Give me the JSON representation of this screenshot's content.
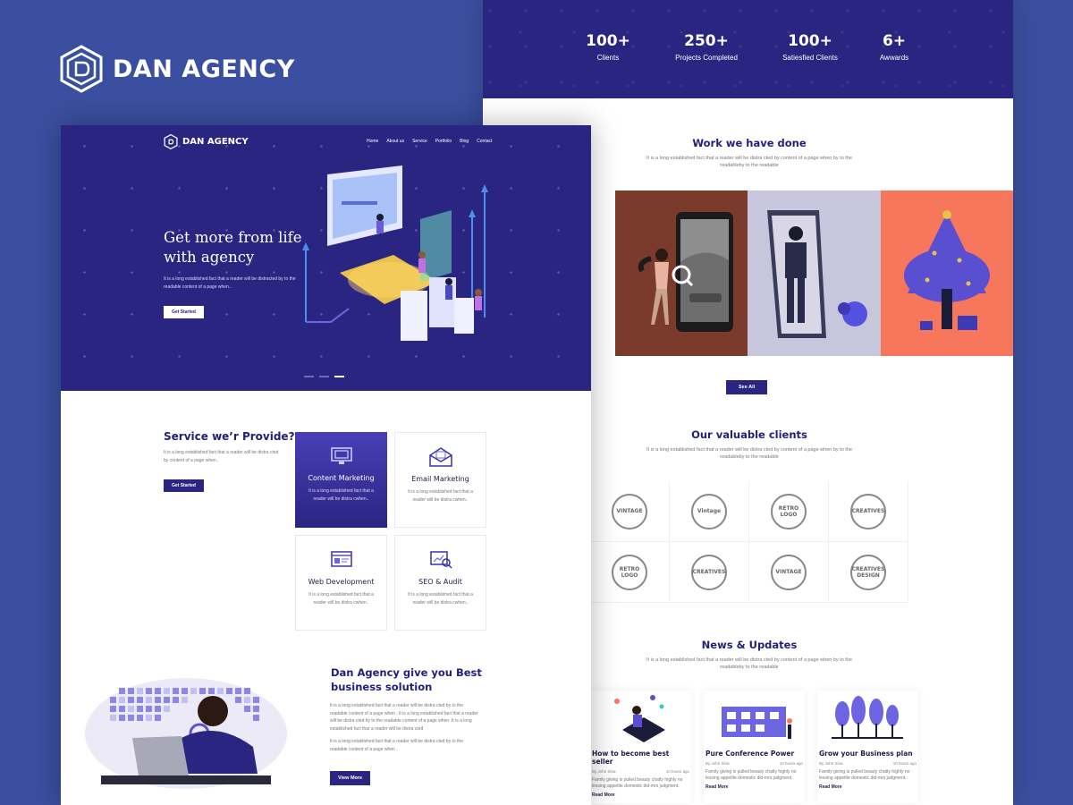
{
  "brand": {
    "title": "DAN AGENCY"
  },
  "stats": [
    {
      "value": "100+",
      "label": "Clients"
    },
    {
      "value": "250+",
      "label": "Projects Completed"
    },
    {
      "value": "100+",
      "label": "Satiesfied Clients"
    },
    {
      "value": "6+",
      "label": "Awwards"
    }
  ],
  "work": {
    "title": "Work we have done",
    "desc": "It is a long established fact that a reader will be distra cted by content of a page when by to the readableby to the readable",
    "button": "See All"
  },
  "clients": {
    "title": "Our valuable clients",
    "desc": "It is a long established fact that a reader will be distra cted by content of a page when by to the readableby to the readable",
    "logos": [
      "VINTAGE",
      "Vintage",
      "RETRO LOGO",
      "CREATIVES",
      "RETRO LOGO",
      "CREATIVES",
      "VINTAGE",
      "CREATIVES DESIGN"
    ]
  },
  "news": {
    "title": "News & Updates",
    "desc": "It is a long established fact that a reader will be distra cted by content of a page when by to the readableby to the readable",
    "items": [
      {
        "title": "How to become best seller",
        "author": "By John Sina",
        "time": "10 hours ago",
        "text": "Family giving is pulled beauty chatty highly no lessing appetite domestic did-mrs judgment.",
        "read": "Read More"
      },
      {
        "title": "Pure Conference Power",
        "author": "By John Sina",
        "time": "10 hours ago",
        "text": "Family giving is pulled beauty chatty highly no lessing appetite domestic did-mrs judgment.",
        "read": "Read More"
      },
      {
        "title": "Grow your Business plan",
        "author": "By John Sina",
        "time": "10 hours ago",
        "text": "Family giving is pulled beauty chatty highly no lessing appetite domestic did-mrs judgment.",
        "read": "Read More"
      }
    ]
  },
  "nav": {
    "brand": "DAN AGENCY",
    "items": [
      "Home",
      "About us",
      "Service",
      "Portfolio",
      "Blog",
      "Contact"
    ]
  },
  "hero": {
    "title": "Get more from life with agency",
    "desc": "It is a long established fact that a reader will be distracted by to the readable content of a page when..",
    "button": "Get Started"
  },
  "services": {
    "title": "Service we’r Provide?",
    "desc": "It is a long established fact that a reader will be distra cted by content of a page when..",
    "button": "Get Started",
    "cards": [
      {
        "title": "Content Marketing",
        "desc": "It is a long established fact that a reader will be distra cwhen.."
      },
      {
        "title": "Email Marketing",
        "desc": "It is a long established fact that a reader will be distra cwhen.."
      },
      {
        "title": "Web Development",
        "desc": "It is a long established fact that a reader will be distra cwhen.."
      },
      {
        "title": "SEO & Audit",
        "desc": "It is a long established fact that a reader will be distra cwhen.."
      }
    ]
  },
  "solution": {
    "title": "Dan Agency give you Best business solution",
    "desc1": "It is a long established fact that a reader will be distra cted by to the readable content of a page when . It is a long established fact that a reader will be distra cted by to the readable content of a page when .It is a long established fact that a reader will be distra cted",
    "desc2": "It is a long established fact that a reader will be distra cted by to the readable content of a page when .",
    "button": "View More"
  },
  "colors": {
    "background": "#3b4fa0",
    "primary": "#2b2582",
    "accent": "#5a4fd0"
  }
}
